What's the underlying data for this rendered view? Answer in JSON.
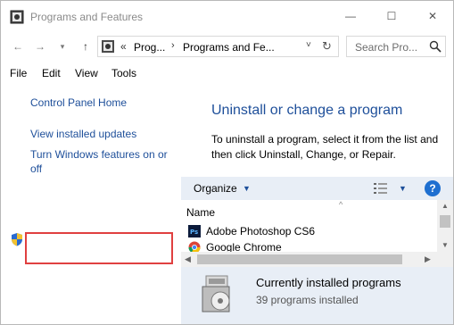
{
  "window": {
    "title": "Programs and Features",
    "controls": {
      "minimize": "—",
      "maximize": "☐",
      "close": "✕"
    }
  },
  "nav": {
    "back": "←",
    "forward": "→",
    "recent": "▾",
    "up": "↑",
    "breadcrumb_sep_root": "«",
    "breadcrumb": [
      "Prog...",
      "Programs and Fe..."
    ],
    "breadcrumb_sep": "›",
    "address_dropdown": "˅",
    "refresh": "↻",
    "search_placeholder": "Search Pro..."
  },
  "menu": [
    "File",
    "Edit",
    "View",
    "Tools"
  ],
  "left_pane": {
    "links": [
      "Control Panel Home",
      "View installed updates"
    ],
    "features_link_line1": "Turn Windows features on or",
    "features_link_line2": "off"
  },
  "main": {
    "heading": "Uninstall or change a program",
    "description": "To uninstall a program, select it from the list and then click Uninstall, Change, or Repair."
  },
  "toolbar": {
    "organize": "Organize",
    "dropdown_glyph": "▼",
    "help": "?"
  },
  "list": {
    "column": "Name",
    "sort_glyph": "^",
    "rows": [
      {
        "name": "Adobe Photoshop CS6",
        "icon": "photoshop-icon"
      },
      {
        "name": "Google Chrome",
        "icon": "chrome-icon"
      }
    ],
    "scroll_up": "▲",
    "scroll_down": "▼",
    "scroll_left": "◀",
    "scroll_right": "▶"
  },
  "details": {
    "title": "Currently installed programs",
    "subtitle": "39 programs installed"
  },
  "colors": {
    "link": "#1e4f9a",
    "toolbar_bg": "#e8eef6",
    "highlight_border": "#e04040"
  }
}
